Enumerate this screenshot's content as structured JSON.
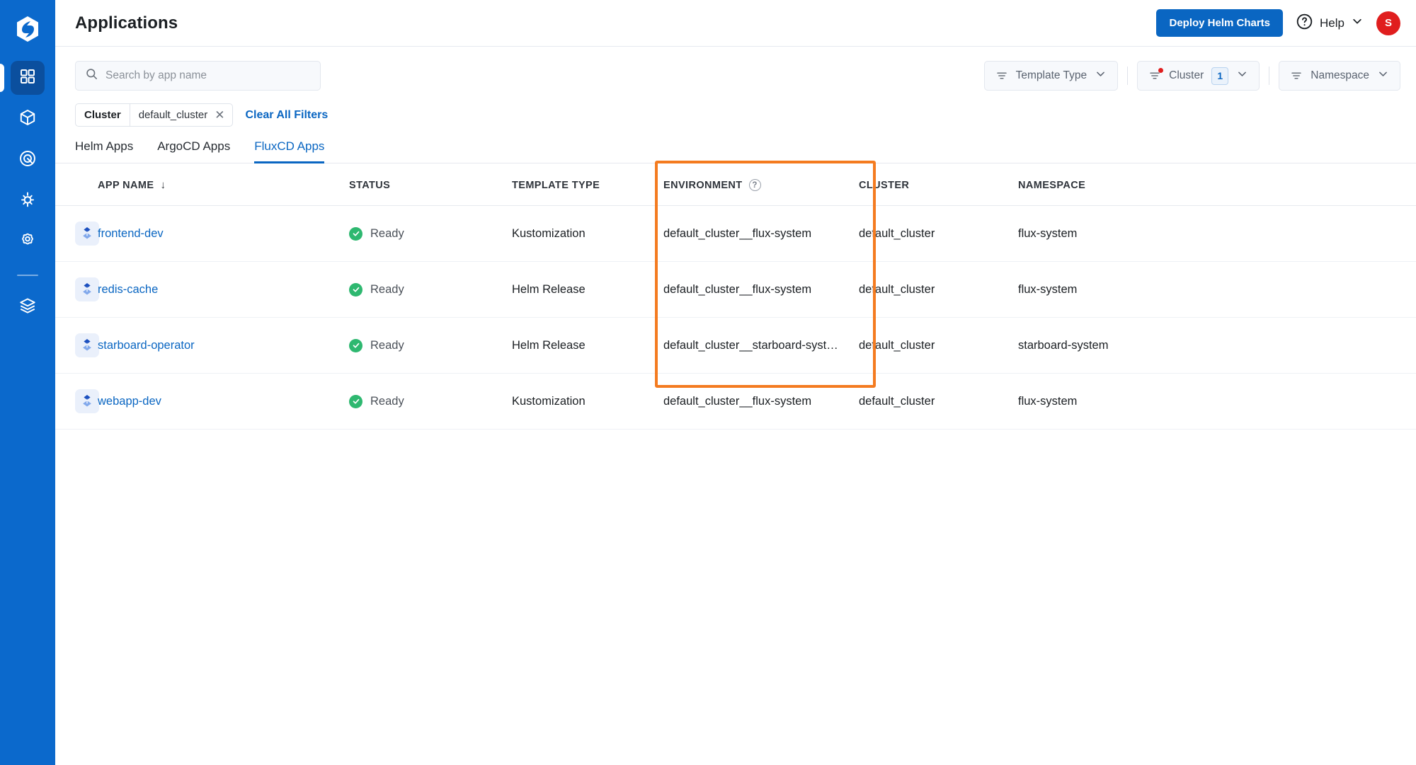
{
  "sidebar": {
    "logo_icon": "devtron-logo-icon",
    "items": [
      {
        "icon": "grid-apps-icon",
        "name": "applications",
        "active": true
      },
      {
        "icon": "cube-chart-store-icon",
        "name": "chart-store",
        "active": false
      },
      {
        "icon": "target-security-icon",
        "name": "security",
        "active": false
      },
      {
        "icon": "sun-bulk-edit-icon",
        "name": "bulk-edit",
        "active": false
      },
      {
        "icon": "gear-global-config-icon",
        "name": "global-configurations",
        "active": false
      },
      {
        "icon": "layers-stack-manager-icon",
        "name": "stack-manager",
        "active": false
      }
    ]
  },
  "header": {
    "title": "Applications",
    "deploy_button": "Deploy Helm Charts",
    "help_label": "Help",
    "help_icon": "question-circle-icon",
    "help_chevron_icon": "chevron-down-icon",
    "avatar_initial": "S",
    "avatar_color": "#E01E1E",
    "accent_color": "#0A66C2"
  },
  "search": {
    "placeholder": "Search by app name",
    "value": "",
    "icon": "search-icon"
  },
  "filters": {
    "template_type": {
      "label": "Template Type",
      "icon": "filter-icon",
      "chevron": "chevron-down-icon",
      "active": false,
      "count": null
    },
    "cluster": {
      "label": "Cluster",
      "icon": "filter-icon",
      "chevron": "chevron-down-icon",
      "active": true,
      "count": "1"
    },
    "namespace": {
      "label": "Namespace",
      "icon": "filter-icon",
      "chevron": "chevron-down-icon",
      "active": false,
      "count": null
    }
  },
  "applied_filters": {
    "chips": [
      {
        "key": "Cluster",
        "value": "default_cluster",
        "remove_icon": "close-icon"
      }
    ],
    "clear_all_label": "Clear All Filters"
  },
  "tabs": [
    {
      "label": "Helm Apps",
      "active": false
    },
    {
      "label": "ArgoCD Apps",
      "active": false
    },
    {
      "label": "FluxCD Apps",
      "active": true
    }
  ],
  "table": {
    "columns": [
      {
        "label": "APP NAME",
        "sort_icon": "arrow-down-icon",
        "sorted": true
      },
      {
        "label": "STATUS"
      },
      {
        "label": "TEMPLATE TYPE"
      },
      {
        "label": "ENVIRONMENT",
        "info_icon": "question-circle-icon"
      },
      {
        "label": "CLUSTER"
      },
      {
        "label": "NAMESPACE"
      }
    ],
    "rows": [
      {
        "icon": "fluxcd-app-icon",
        "app_name": "frontend-dev",
        "status": "Ready",
        "status_icon": "check-circle-icon",
        "template_type": "Kustomization",
        "environment": "default_cluster__flux-system",
        "cluster": "default_cluster",
        "namespace": "flux-system"
      },
      {
        "icon": "fluxcd-app-icon",
        "app_name": "redis-cache",
        "status": "Ready",
        "status_icon": "check-circle-icon",
        "template_type": "Helm Release",
        "environment": "default_cluster__flux-system",
        "cluster": "default_cluster",
        "namespace": "flux-system"
      },
      {
        "icon": "fluxcd-app-icon",
        "app_name": "starboard-operator",
        "status": "Ready",
        "status_icon": "check-circle-icon",
        "template_type": "Helm Release",
        "environment": "default_cluster__starboard-syst…",
        "cluster": "default_cluster",
        "namespace": "starboard-system"
      },
      {
        "icon": "fluxcd-app-icon",
        "app_name": "webapp-dev",
        "status": "Ready",
        "status_icon": "check-circle-icon",
        "template_type": "Kustomization",
        "environment": "default_cluster__flux-system",
        "cluster": "default_cluster",
        "namespace": "flux-system"
      }
    ]
  },
  "annotation": {
    "type": "highlight-rectangle",
    "color": "#F47B20",
    "target": "environment-column"
  }
}
